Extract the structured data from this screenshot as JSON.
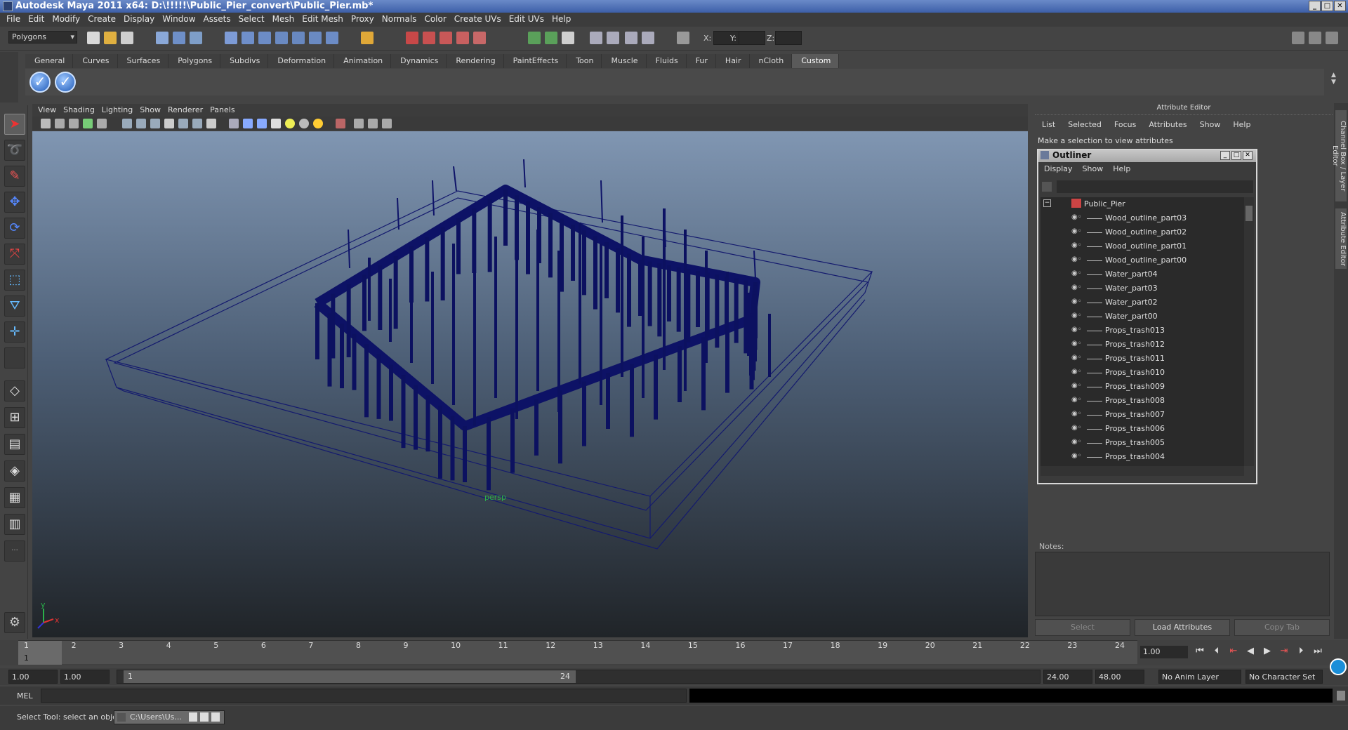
{
  "window": {
    "title": "Autodesk Maya 2011 x64: D:\\!!!!!\\Public_Pier_convert\\Public_Pier.mb*"
  },
  "menubar": [
    "File",
    "Edit",
    "Modify",
    "Create",
    "Display",
    "Window",
    "Assets",
    "Select",
    "Mesh",
    "Edit Mesh",
    "Proxy",
    "Normals",
    "Color",
    "Create UVs",
    "Edit UVs",
    "Help"
  ],
  "statusline": {
    "mode": "Polygons",
    "x_label": "X:",
    "y_label": "Y:",
    "z_label": "Z:"
  },
  "shelf": {
    "tabs": [
      "General",
      "Curves",
      "Surfaces",
      "Polygons",
      "Subdivs",
      "Deformation",
      "Animation",
      "Dynamics",
      "Rendering",
      "PaintEffects",
      "Toon",
      "Muscle",
      "Fluids",
      "Fur",
      "Hair",
      "nCloth",
      "Custom"
    ],
    "active_tab": "Custom"
  },
  "viewport": {
    "menu": [
      "View",
      "Shading",
      "Lighting",
      "Show",
      "Renderer",
      "Panels"
    ],
    "camera_label": "persp",
    "axis": {
      "y": "y",
      "x": "x"
    }
  },
  "attribute_editor": {
    "title": "Attribute Editor",
    "menu": [
      "List",
      "Selected",
      "Focus",
      "Attributes",
      "Show",
      "Help"
    ],
    "message": "Make a selection to view attributes",
    "notes_label": "Notes:",
    "buttons": {
      "select": "Select",
      "load": "Load Attributes",
      "copy": "Copy Tab"
    }
  },
  "outliner": {
    "title": "Outliner",
    "menu": [
      "Display",
      "Show",
      "Help"
    ],
    "root": "Public_Pier",
    "items": [
      "Wood_outline_part03",
      "Wood_outline_part02",
      "Wood_outline_part01",
      "Wood_outline_part00",
      "Water_part04",
      "Water_part03",
      "Water_part02",
      "Water_part00",
      "Props_trash013",
      "Props_trash012",
      "Props_trash011",
      "Props_trash010",
      "Props_trash009",
      "Props_trash008",
      "Props_trash007",
      "Props_trash006",
      "Props_trash005",
      "Props_trash004"
    ]
  },
  "side_tabs": [
    "Channel Box / Layer Editor",
    "Attribute Editor"
  ],
  "timeline": {
    "ticks": [
      "1",
      "2",
      "3",
      "4",
      "5",
      "6",
      "7",
      "8",
      "9",
      "10",
      "11",
      "12",
      "13",
      "14",
      "15",
      "16",
      "17",
      "18",
      "19",
      "20",
      "21",
      "22",
      "23",
      "24"
    ],
    "current_frame": "1.00",
    "current_marker": "1"
  },
  "range": {
    "start": "1.00",
    "start2": "1.00",
    "slider_start": "1",
    "slider_end": "24",
    "end": "24.00",
    "end2": "48.00",
    "anim_layer": "No Anim Layer",
    "char_set": "No Character Set"
  },
  "cmdline": {
    "label": "MEL"
  },
  "helpline": {
    "text": "Select Tool: select an object",
    "task": "C:\\Users\\Us..."
  }
}
